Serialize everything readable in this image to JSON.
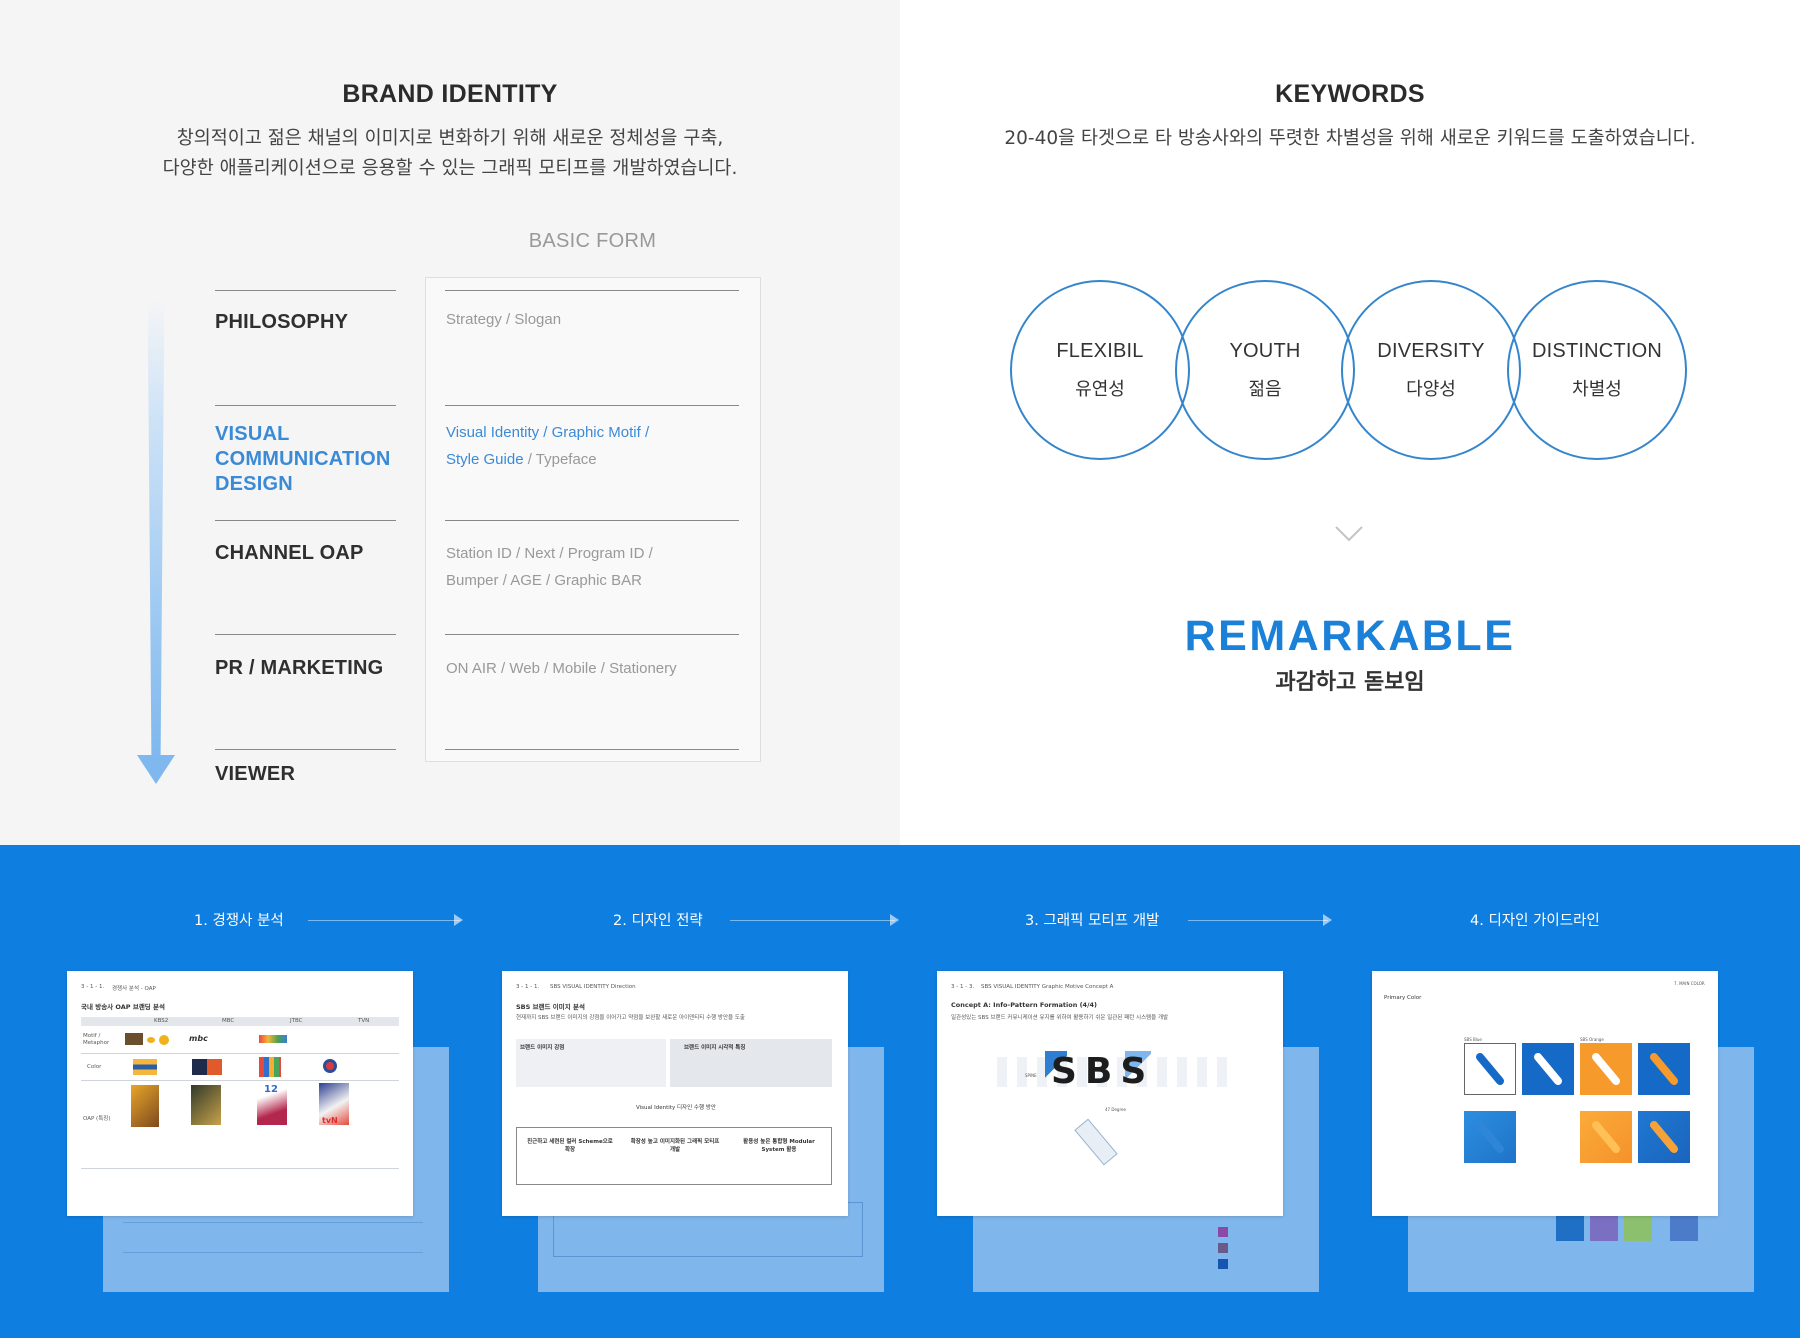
{
  "brand_identity": {
    "title": "BRAND IDENTITY",
    "desc_line1": "창의적이고 젊은 채널의 이미지로 변화하기 위해 새로운 정체성을 구축,",
    "desc_line2": "다양한 애플리케이션으로 응용할 수 있는 그래픽 모티프를 개발하였습니다.",
    "basic_form_label": "BASIC FORM",
    "categories": [
      {
        "label_lines": [
          "PHILOSOPHY"
        ],
        "highlight": false
      },
      {
        "label_lines": [
          "VISUAL",
          "COMMUNICATION",
          "DESIGN"
        ],
        "highlight": true
      },
      {
        "label_lines": [
          "CHANNEL OAP"
        ],
        "highlight": false
      },
      {
        "label_lines": [
          "PR / MARKETING"
        ],
        "highlight": false
      },
      {
        "label_lines": [
          "VIEWER"
        ],
        "highlight": false
      }
    ],
    "forms": {
      "philosophy": "Strategy / Slogan",
      "vcd_line1": "Visual Identity / Graphic Motif /",
      "vcd_line2_blue": "Style Guide",
      "vcd_line2_grey": "/ Typeface",
      "oap_line1": "Station ID / Next / Program ID /",
      "oap_line2": "Bumper / AGE / Graphic BAR",
      "pr": "ON AIR / Web / Mobile / Stationery"
    },
    "colors": {
      "highlight": "#3b8ad6",
      "arrow": "#7eb8ee"
    }
  },
  "keywords": {
    "title": "KEYWORDS",
    "desc": "20-40을 타겟으로 타 방송사와의 뚜렷한 차별성을 위해 새로운 키워드를 도출하였습니다.",
    "items": [
      {
        "en": "FLEXIBIL",
        "ko": "유연성"
      },
      {
        "en": "YOUTH",
        "ko": "젊음"
      },
      {
        "en": "DIVERSITY",
        "ko": "다양성"
      },
      {
        "en": "DISTINCTION",
        "ko": "차별성"
      }
    ],
    "chevron_icon": "chevron-down-icon",
    "result_en": "REMARKABLE",
    "result_ko": "과감하고 돋보임",
    "colors": {
      "circle": "#3585cc",
      "result": "#1a80d8"
    }
  },
  "process": {
    "background": "#0e7ee0",
    "steps": [
      {
        "label": "1. 경쟁사 분석"
      },
      {
        "label": "2. 디자인 전략"
      },
      {
        "label": "3. 그래픽 모티프 개발"
      },
      {
        "label": "4. 디자인 가이드라인"
      }
    ],
    "thumbs": {
      "t1": {
        "crumb": "3 - 1 - 1.",
        "crumb_title": "경쟁사 분석 - OAP",
        "title": "국내 방송사 OAP 브랜딩 분석",
        "columns": [
          "KBS2",
          "MBC",
          "JTBC",
          "TVN"
        ],
        "rows": [
          "Motif / Metaphor",
          "Color",
          "OAP (특징)"
        ],
        "logo_mbc": "mbc",
        "logo_tvn": "tvN",
        "num_12": "12"
      },
      "t2": {
        "crumb": "3 - 1 - 1.",
        "crumb_title": "SBS VISUAL IDENTITY Direction",
        "title": "SBS 브랜드 이미지 분석",
        "subtitle": "현재까지 SBS 브랜드 이미지의 강점을 이어가고 약점을 보완할 새로운 아이덴티티 수행 방안을 도출",
        "box1_title": "브랜드 이미지 강점",
        "box2_title": "브랜드 이미지 시각적 특징",
        "mid_label": "Visual Identity 디자인 수행 방안",
        "col1": "친근하고 세련된 컬러 Scheme으로 확장",
        "col2": "확장성 높고 이미지화된 그래픽 모티프 개발",
        "col3": "활용성 높은 통합형 Modular System 활용"
      },
      "t3": {
        "crumb": "3 - 1 - 3.",
        "crumb_title": "SBS VISUAL IDENTITY Graphic Motive Concept A",
        "title": "Concept A: Info-Pattern Formation (4/4)",
        "subtitle": "일관성있는 SBS 브랜드 커뮤니케이션 유지를 위하여 활용하기 쉬운 일관된 패턴 시스템을 개발",
        "logo": "SBS",
        "tag": "SPINE",
        "angle": "47 Degree"
      },
      "t4": {
        "top_label": "7. MAIN COLOR",
        "title": "Primary Color",
        "group1": "SBS Blue",
        "group2": "SBS Orange"
      }
    },
    "colors": {
      "tile_blue": "#1569c7",
      "tile_orange": "#f79a2c",
      "tile_light": "#3a8fdf"
    }
  }
}
